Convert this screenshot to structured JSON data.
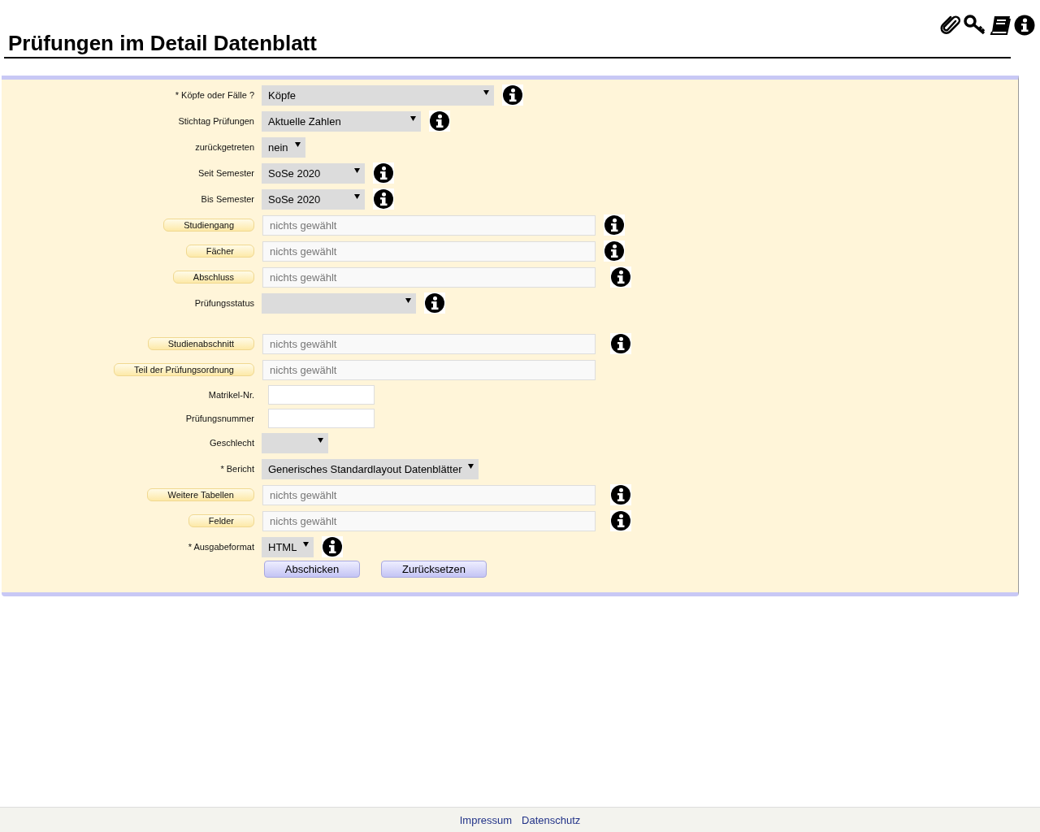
{
  "header": {
    "title": "Prüfungen im Detail Datenblatt"
  },
  "form": {
    "rows": [
      {
        "kind": "select",
        "label": "* Köpfe oder Fälle ?",
        "value": "Köpfe",
        "info": true
      },
      {
        "kind": "select",
        "label": "Stichtag Prüfungen",
        "value": "Aktuelle Zahlen",
        "info": true
      },
      {
        "kind": "select",
        "label": "zurückgetreten",
        "value": "nein",
        "info": false
      },
      {
        "kind": "select",
        "label": "Seit Semester",
        "value": "SoSe 2020",
        "info": true
      },
      {
        "kind": "select",
        "label": "Bis Semester",
        "value": "SoSe 2020",
        "info": true
      },
      {
        "kind": "picker",
        "label": "Studiengang",
        "placeholder": "nichts gewählt",
        "info": true
      },
      {
        "kind": "picker",
        "label": "Fächer",
        "placeholder": "nichts gewählt",
        "info": true
      },
      {
        "kind": "picker",
        "label": "Abschluss",
        "placeholder": "nichts gewählt",
        "info": true
      },
      {
        "kind": "select",
        "label": "Prüfungsstatus",
        "info": true
      },
      {
        "kind": "picker",
        "label": "Studienabschnitt",
        "placeholder": "nichts gewählt",
        "info": true
      },
      {
        "kind": "picker",
        "label": "Teil der Prüfungsordnung",
        "placeholder": "nichts gewählt",
        "info": false
      },
      {
        "kind": "text",
        "label": "Matrikel-Nr.",
        "info": false
      },
      {
        "kind": "text",
        "label": "Prüfungsnummer",
        "info": false
      },
      {
        "kind": "select",
        "label": "Geschlecht",
        "info": false
      },
      {
        "kind": "select",
        "label": "* Bericht",
        "value": "Generisches Standardlayout Datenblätter",
        "info": false
      },
      {
        "kind": "picker",
        "label": "Weitere Tabellen",
        "placeholder": "nichts gewählt",
        "info": true
      },
      {
        "kind": "picker",
        "label": "Felder",
        "placeholder": "nichts gewählt",
        "info": true
      },
      {
        "kind": "select",
        "label": "* Ausgabeformat",
        "value": "HTML",
        "info": true
      }
    ],
    "buttons": [
      "Abschicken",
      "Zurücksetzen"
    ]
  },
  "footer": {
    "links": [
      "Impressum",
      "Datenschutz"
    ]
  }
}
